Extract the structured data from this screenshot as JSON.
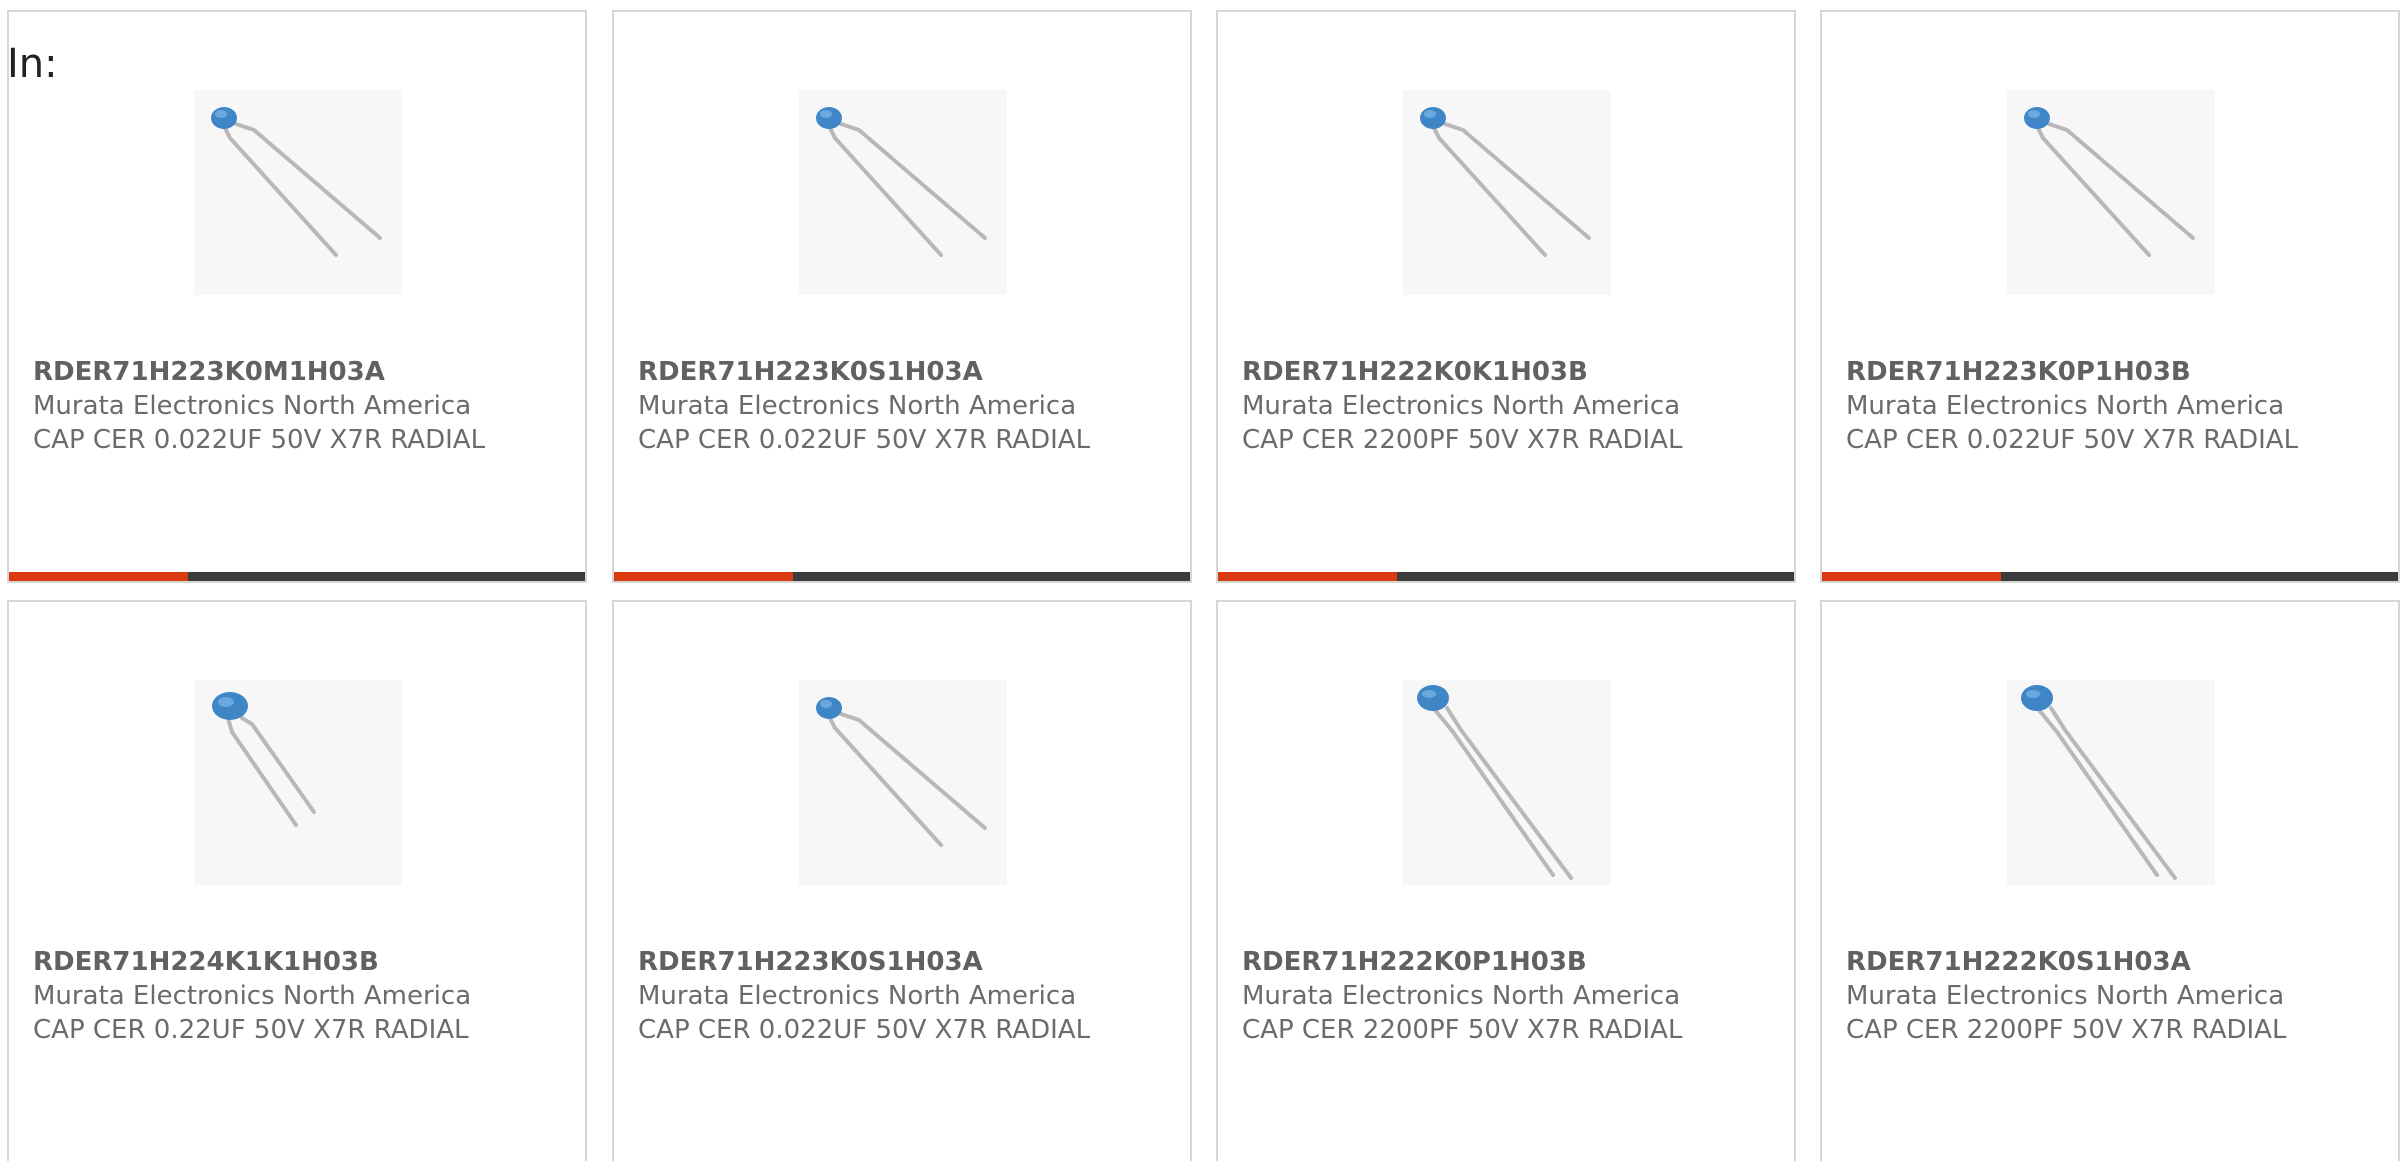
{
  "header": {
    "in_label": "In:"
  },
  "products": [
    {
      "part_number": "RDER71H223K0M1H03A",
      "manufacturer": "Murata Electronics North America",
      "description": "CAP CER 0.022UF 50V X7R RADIAL",
      "image": "radial-ceramic-capacitor-small",
      "progress": 0.31
    },
    {
      "part_number": "RDER71H223K0S1H03A",
      "manufacturer": "Murata Electronics North America",
      "description": "CAP CER 0.022UF 50V X7R RADIAL",
      "image": "radial-ceramic-capacitor-small",
      "progress": 0.31
    },
    {
      "part_number": "RDER71H222K0K1H03B",
      "manufacturer": "Murata Electronics North America",
      "description": "CAP CER 2200PF 50V X7R RADIAL",
      "image": "radial-ceramic-capacitor-small",
      "progress": 0.31
    },
    {
      "part_number": "RDER71H223K0P1H03B",
      "manufacturer": "Murata Electronics North America",
      "description": "CAP CER 0.022UF 50V X7R RADIAL",
      "image": "radial-ceramic-capacitor-small",
      "progress": 0.31
    },
    {
      "part_number": "RDER71H224K1K1H03B",
      "manufacturer": "Murata Electronics North America",
      "description": "CAP CER 0.22UF 50V X7R RADIAL",
      "image": "radial-ceramic-capacitor-large",
      "progress": null
    },
    {
      "part_number": "RDER71H223K0S1H03A",
      "manufacturer": "Murata Electronics North America",
      "description": "CAP CER 0.022UF 50V X7R RADIAL",
      "image": "radial-ceramic-capacitor-small",
      "progress": null
    },
    {
      "part_number": "RDER71H222K0P1H03B",
      "manufacturer": "Murata Electronics North America",
      "description": "CAP CER 2200PF 50V X7R RADIAL",
      "image": "radial-ceramic-capacitor-tall",
      "progress": null
    },
    {
      "part_number": "RDER71H222K0S1H03A",
      "manufacturer": "Murata Electronics North America",
      "description": "CAP CER 2200PF 50V X7R RADIAL",
      "image": "radial-ceramic-capacitor-tall",
      "progress": null
    }
  ],
  "colors": {
    "progress_fill": "#d93a10",
    "progress_track": "#3c3c3c",
    "card_border": "#d6d6d6",
    "capacitor_body": "#3f86c6",
    "lead_wire": "#b8b8b8"
  }
}
